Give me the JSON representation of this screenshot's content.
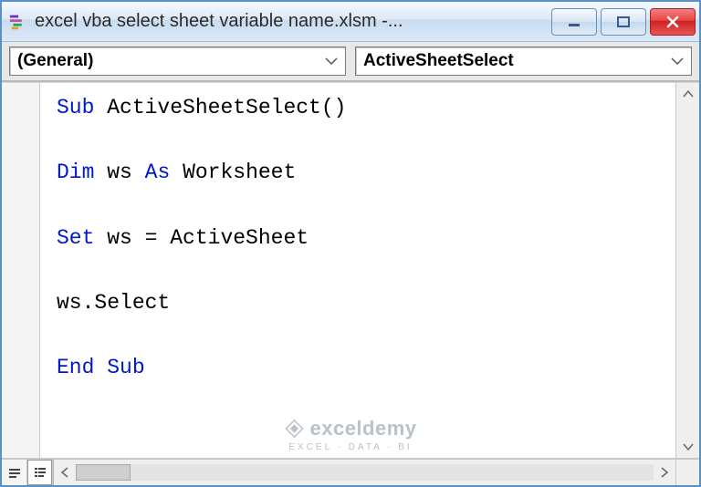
{
  "window": {
    "title": "excel vba select sheet variable name.xlsm -..."
  },
  "dropdowns": {
    "object": "(General)",
    "procedure": "ActiveSheetSelect"
  },
  "code": {
    "lines": [
      [
        {
          "t": "Sub ",
          "c": "kw"
        },
        {
          "t": "ActiveSheetSelect()",
          "c": ""
        }
      ],
      [],
      [
        {
          "t": "Dim ",
          "c": "kw"
        },
        {
          "t": "ws ",
          "c": ""
        },
        {
          "t": "As ",
          "c": "kw"
        },
        {
          "t": "Worksheet",
          "c": ""
        }
      ],
      [],
      [
        {
          "t": "Set ",
          "c": "kw"
        },
        {
          "t": "ws = ActiveSheet",
          "c": ""
        }
      ],
      [],
      [
        {
          "t": "ws.Select",
          "c": ""
        }
      ],
      [],
      [
        {
          "t": "End Sub",
          "c": "kw"
        }
      ]
    ]
  },
  "watermark": {
    "brand": "exceldemy",
    "tagline": "EXCEL · DATA · BI"
  }
}
